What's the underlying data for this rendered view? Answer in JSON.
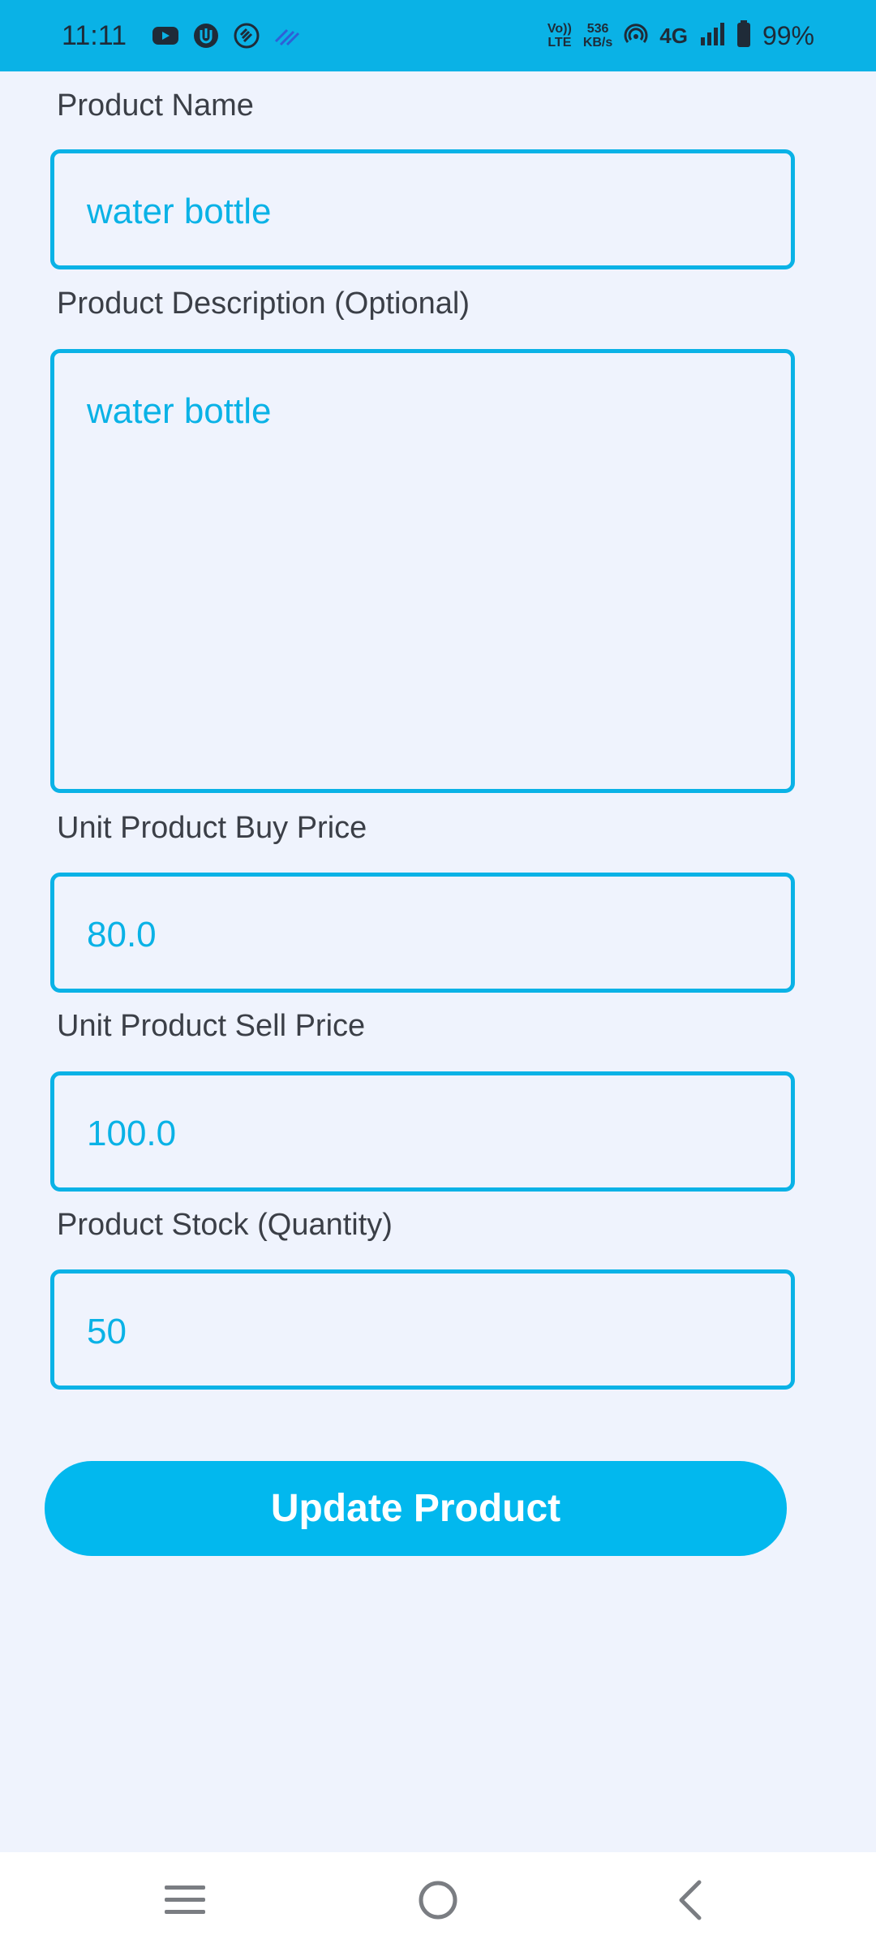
{
  "status_bar": {
    "time": "11:11",
    "left_icons": [
      "youtube-icon",
      "app-badge-icon",
      "shazam-icon",
      "waves-icon"
    ],
    "volte_top": "Vo))",
    "volte_bottom": "LTE",
    "speed_value": "536",
    "speed_unit": "KB/s",
    "network": "4G",
    "battery": "99%"
  },
  "form": {
    "product_name": {
      "label": "Product Name",
      "value": "water bottle"
    },
    "product_description": {
      "label": "Product Description (Optional)",
      "value": "water bottle"
    },
    "buy_price": {
      "label": "Unit Product Buy Price",
      "value": "80.0"
    },
    "sell_price": {
      "label": "Unit Product Sell Price",
      "value": "100.0"
    },
    "stock": {
      "label": "Product Stock (Quantity)",
      "value": "50"
    },
    "submit_label": "Update Product"
  },
  "nav_bar": {
    "items": [
      "menu-icon",
      "home-icon",
      "back-icon"
    ]
  },
  "colors": {
    "accent": "#0AB2E6",
    "button": "#02B8EE",
    "background": "#EFF3FD",
    "label_text": "#3B3F47"
  }
}
